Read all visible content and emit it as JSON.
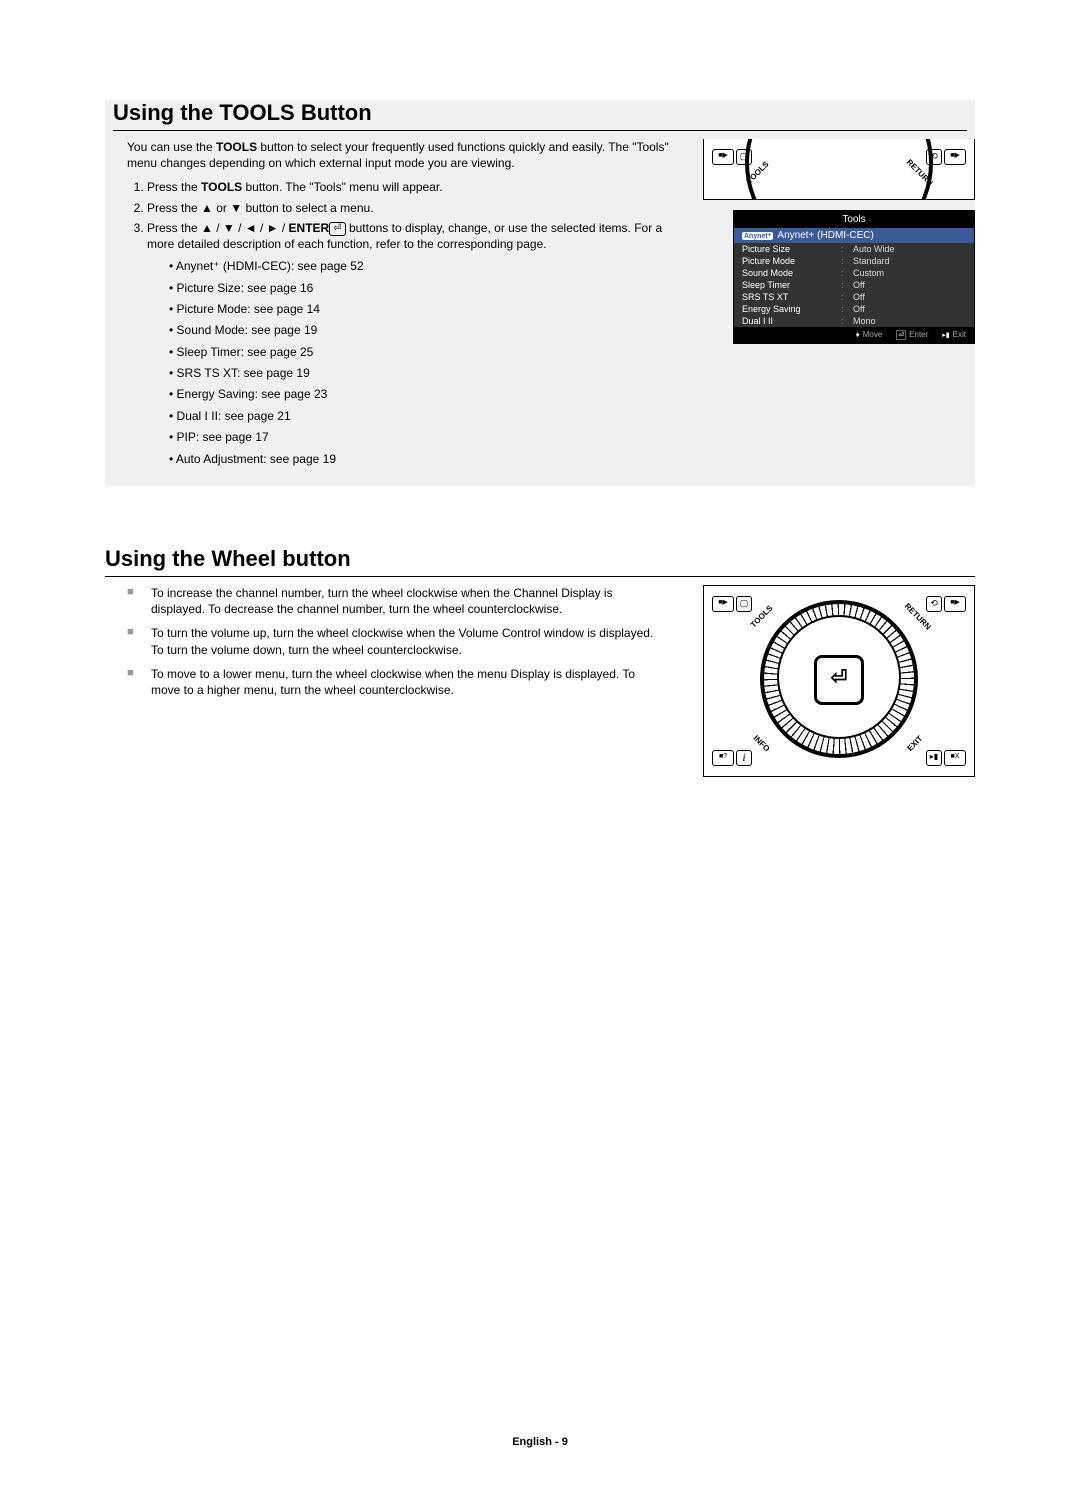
{
  "section1": {
    "title": "Using the TOOLS Button",
    "intro_pre": "You can use the ",
    "intro_bold": "TOOLS",
    "intro_post": " button to select your frequently used functions quickly and easily. The \"Tools\" menu changes depending on which external input mode you are viewing.",
    "step1_pre": "Press the ",
    "step1_bold": "TOOLS",
    "step1_post": " button. The \"Tools\" menu will appear.",
    "step2": "Press the ▲ or ▼ button to select a menu.",
    "step3_pre": "Press the ▲ / ▼ / ◄ / ► / ",
    "step3_bold": "ENTER",
    "step3_post": " buttons to display, change, or use the selected items. For a more detailed description of each function, refer to the corresponding page.",
    "refs": [
      "Anynet⁺ (HDMI-CEC): see page 52",
      "Picture Size: see page 16",
      "Picture Mode: see page 14",
      "Sound Mode: see page 19",
      "Sleep Timer: see page 25",
      "SRS TS XT: see page 19",
      "Energy Saving: see page 23",
      "Dual I II: see page 21",
      "PIP: see page 17",
      "Auto Adjustment: see page 19"
    ]
  },
  "remote": {
    "tools": "TOOLS",
    "return": "RETURN",
    "info": "INFO",
    "exit": "EXIT",
    "btn_e": "■▶",
    "enter_glyph": "⏎"
  },
  "osd": {
    "title": "Tools",
    "highlight": "Anynet+ (HDMI-CEC)",
    "rows": [
      {
        "label": "Picture Size",
        "value": "Auto Wide"
      },
      {
        "label": "Picture Mode",
        "value": "Standard"
      },
      {
        "label": "Sound Mode",
        "value": "Custom"
      },
      {
        "label": "Sleep Timer",
        "value": "Off"
      },
      {
        "label": "SRS TS XT",
        "value": "Off"
      },
      {
        "label": "Energy Saving",
        "value": "Off"
      },
      {
        "label": "Dual I II",
        "value": "Mono"
      }
    ],
    "footer": {
      "move": "Move",
      "enter": "Enter",
      "exit": "Exit"
    }
  },
  "section2": {
    "title": "Using the Wheel button",
    "items": [
      "To increase the channel number, turn the wheel clockwise when the Channel Display is displayed. To decrease the channel number, turn the wheel counterclockwise.",
      "To turn the volume up, turn the wheel clockwise when the Volume Control window is displayed. To turn the volume down, turn the wheel counterclockwise.",
      "To move to a lower menu, turn the wheel clockwise when the menu Display is displayed. To move to a higher menu, turn the wheel counterclockwise."
    ]
  },
  "footer": "English - 9"
}
